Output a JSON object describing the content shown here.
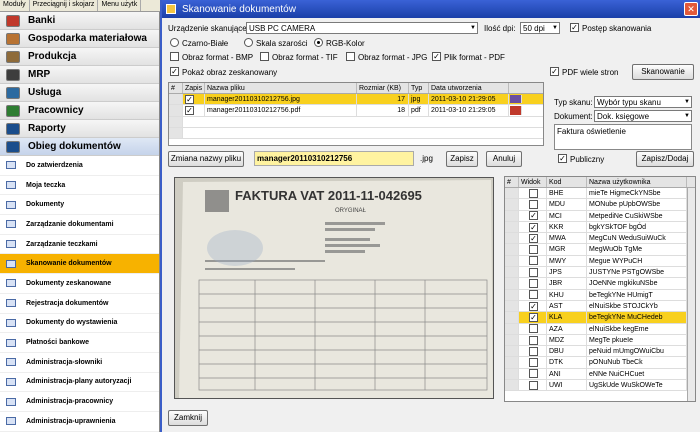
{
  "topbar": {
    "items": [
      "Moduły",
      "Przeciągnij i skojarz",
      "Menu użytk"
    ]
  },
  "modules": [
    {
      "label": "Banki",
      "color": "#c0392b"
    },
    {
      "label": "Gospodarka materiałowa",
      "color": "#b87333"
    },
    {
      "label": "Produkcja",
      "color": "#8e6b3a"
    },
    {
      "label": "MRP",
      "color": "#3d3d3d"
    },
    {
      "label": "Usługa",
      "color": "#2c6aa0"
    },
    {
      "label": "Pracownicy",
      "color": "#2e7d32"
    },
    {
      "label": "Raporty",
      "color": "#1a4d8c"
    },
    {
      "label": "Obieg dokumentów",
      "color": "#1a4d8c"
    }
  ],
  "subitems": [
    "Do zatwierdzenia",
    "Moja teczka",
    "Dokumenty",
    "Zarządzanie dokumentami",
    "Zarządzanie teczkami",
    "Skanowanie dokumentów",
    "Dokumenty zeskanowane",
    "Rejestracja dokumentów",
    "Dokumenty do wystawienia",
    "Płatności bankowe",
    "Administracja-słowniki",
    "Administracja-plany autoryzacji",
    "Administracja-pracownicy",
    "Administracja-uprawnienia"
  ],
  "active_subitem": "Skanowanie dokumentów",
  "dialog": {
    "title": "Skanowanie dokumentów",
    "close": "✕",
    "device_label": "Urządzenie skanujące:",
    "device_value": "USB PC CAMERA",
    "dpi_label": "Ilość dpi:",
    "dpi_value": "50 dpi",
    "progress_label": "Postęp skanowania",
    "radio_bw": "Czarno-Białe",
    "radio_gray": "Skala szarości",
    "radio_rgb": "RGB-Kolor",
    "fmt_bmp": "Obraz format - BMP",
    "fmt_tif": "Obraz format - TIF",
    "fmt_jpg": "Obraz format - JPG",
    "fmt_pdf": "Plik format - PDF",
    "multi_pdf": "PDF wiele stron",
    "scan_btn": "Skanowanie",
    "show_scanned": "Pokaż obraz zeskanowany",
    "scan_type_label": "Typ skanu:",
    "scan_type_value": "Wybór typu skanu",
    "document_label": "Dokument:",
    "document_value": "Dok. księgowe",
    "description": "Faktura oświetlenie",
    "rename_btn": "Zmiana nazwy pliku",
    "filename": "manager20110310212756",
    "ext": ".jpg",
    "save_btn": "Zapisz",
    "cancel_btn": "Anuluj",
    "public_label": "Publiczny",
    "save_add_btn": "Zapisz/Dodaj",
    "close_btn": "Zamknij"
  },
  "files": {
    "headers": [
      "#",
      "Zapis",
      "Nazwa pliku",
      "Rozmiar (KB)",
      "Typ",
      "Data utworzenia"
    ],
    "rows": [
      {
        "zapis": true,
        "name": "manager20110310212756.jpg",
        "size": "17",
        "type": "jpg",
        "date": "2011-03-10 21:29:05"
      },
      {
        "zapis": true,
        "name": "manager20110310212756.pdf",
        "size": "18",
        "type": "pdf",
        "date": "2011-03-10 21:29:05"
      }
    ]
  },
  "users": {
    "headers": [
      "#",
      "Widok",
      "Kod",
      "Nazwa użytkownika"
    ],
    "rows": [
      {
        "v": false,
        "kod": "BHE",
        "name": "mieTe HigmeCkYNSbe"
      },
      {
        "v": false,
        "kod": "MDU",
        "name": "MONube pUpbOWSbe"
      },
      {
        "v": true,
        "kod": "MCI",
        "name": "MetpediNe CuSkiWSbe"
      },
      {
        "v": true,
        "kod": "KKR",
        "name": "bgkYSkTOF bgÓd"
      },
      {
        "v": true,
        "kod": "MWA",
        "name": "MegCuN WeduSuiWuCk"
      },
      {
        "v": false,
        "kod": "MGR",
        "name": "MegWuOb TgMe"
      },
      {
        "v": false,
        "kod": "MWY",
        "name": "Megue WYPuCH"
      },
      {
        "v": false,
        "kod": "JPS",
        "name": "JUSTYNe PSTgOWSbe"
      },
      {
        "v": false,
        "kod": "JBR",
        "name": "JOeNNe mgkikuNSbe"
      },
      {
        "v": false,
        "kod": "KHU",
        "name": "beTegkYNe HUmigT"
      },
      {
        "v": true,
        "kod": "AST",
        "name": "elNuiSkbe STOJCkYb"
      },
      {
        "v": true,
        "kod": "KLA",
        "name": "beTegkYNe MuCHedeb",
        "hl": true
      },
      {
        "v": false,
        "kod": "AZA",
        "name": "elNuiSkbe kegEme"
      },
      {
        "v": false,
        "kod": "MDZ",
        "name": "MegTe pkueIe"
      },
      {
        "v": false,
        "kod": "DBU",
        "name": "peNuid mUmgOWuiCbu"
      },
      {
        "v": false,
        "kod": "DTK",
        "name": "pONuNub TbeCk"
      },
      {
        "v": false,
        "kod": "ANI",
        "name": "eNNe NuiCHCuet"
      },
      {
        "v": false,
        "kod": "UWI",
        "name": "UgSkUde WuSkOWeTe"
      }
    ]
  },
  "scan_image": {
    "title": "FAKTURA VAT 2011-11-042695",
    "subtitle": "ORYGINAŁ"
  }
}
